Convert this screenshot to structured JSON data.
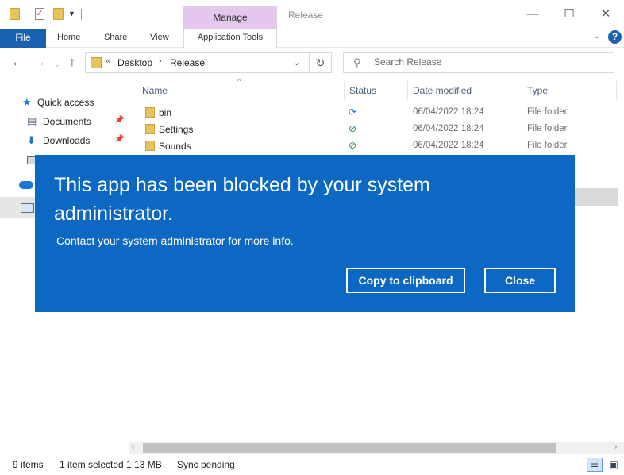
{
  "window": {
    "title": "Release",
    "context_tab": "Manage",
    "minimize_glyph": "—",
    "maximize_glyph": "☐",
    "close_glyph": "✕"
  },
  "ribbon": {
    "tabs": [
      {
        "label": "File"
      },
      {
        "label": "Home"
      },
      {
        "label": "Share"
      },
      {
        "label": "View"
      },
      {
        "label": "Application Tools"
      }
    ],
    "help_glyph": "?"
  },
  "address": {
    "crumbs": [
      "Desktop",
      "Release"
    ],
    "overflow": "«",
    "separator": "›"
  },
  "search": {
    "placeholder": "Search Release"
  },
  "nav": {
    "items": [
      {
        "label": "Quick access"
      },
      {
        "label": "Documents"
      },
      {
        "label": "Downloads"
      }
    ]
  },
  "columns": {
    "name": "Name",
    "status": "Status",
    "date": "Date modified",
    "type": "Type"
  },
  "files": [
    {
      "name": "bin",
      "status": "sync-pending-icon",
      "date": "06/04/2022 18:24",
      "type": "File folder"
    },
    {
      "name": "Settings",
      "status": "synced-check-icon",
      "date": "06/04/2022 18:24",
      "type": "File folder"
    },
    {
      "name": "Sounds",
      "status": "synced-check-icon",
      "date": "06/04/2022 18:24",
      "type": "File folder"
    }
  ],
  "statusbar": {
    "items_count": "9 items",
    "selection": "1 item selected  1.13 MB",
    "sync": "Sync pending"
  },
  "dialog": {
    "title": "This app has been blocked by your system administrator.",
    "message": "Contact your system administrator for more info.",
    "copy_label": "Copy to clipboard",
    "close_label": "Close",
    "background_color": "#0d68c3"
  },
  "colors": {
    "file_tab": "#1a62b0",
    "manage_tab": "#e3c7ec",
    "sync_icon": "#1a77d4",
    "check_icon": "#2e8b3c"
  }
}
